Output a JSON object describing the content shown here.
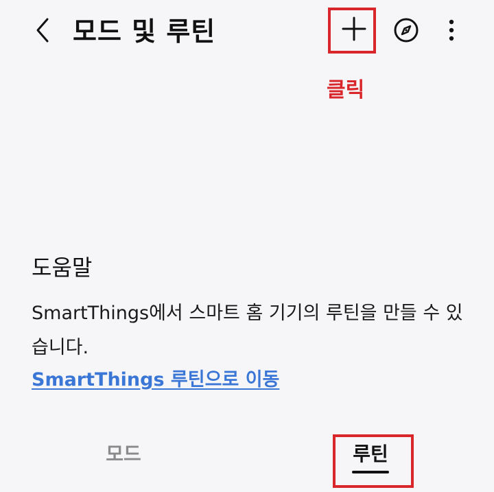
{
  "header": {
    "title": "모드 및 루틴",
    "back_icon": "chevron-left-icon",
    "add_icon": "plus-icon",
    "discover_icon": "compass-icon",
    "more_icon": "more-vertical-icon"
  },
  "annotation": {
    "click_label": "클릭",
    "color": "#d9262a"
  },
  "help": {
    "heading": "도움말",
    "text": "SmartThings에서 스마트 홈 기기의 루틴을 만들 수 있습니다.",
    "link_label": "SmartThings 루틴으로 이동",
    "link_color": "#3a76d6"
  },
  "tabs": [
    {
      "label": "모드",
      "selected": false
    },
    {
      "label": "루틴",
      "selected": true
    }
  ]
}
